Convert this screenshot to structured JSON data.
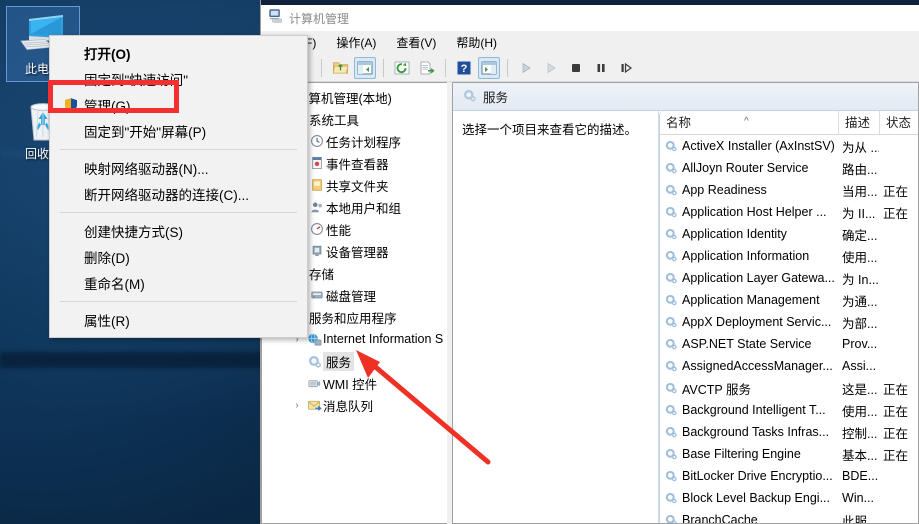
{
  "desktop": {
    "icons": [
      {
        "label": "此电脑",
        "icon": "this-pc-icon",
        "selected": true
      },
      {
        "label": "回收站",
        "icon": "recycle-bin-icon",
        "selected": false
      }
    ]
  },
  "context_menu": {
    "items": [
      {
        "label": "打开(O)",
        "bold": true,
        "icon": ""
      },
      {
        "label": "固定到\"快速访问\"",
        "bold": false,
        "icon": ""
      },
      {
        "label": "管理(G)",
        "bold": false,
        "icon": "shield-icon",
        "highlighted": true
      },
      {
        "label": "固定到\"开始\"屏幕(P)",
        "bold": false,
        "icon": ""
      },
      {
        "separator": true
      },
      {
        "label": "映射网络驱动器(N)...",
        "bold": false,
        "icon": ""
      },
      {
        "label": "断开网络驱动器的连接(C)...",
        "bold": false,
        "icon": ""
      },
      {
        "separator": true
      },
      {
        "label": "创建快捷方式(S)",
        "bold": false,
        "icon": ""
      },
      {
        "label": "删除(D)",
        "bold": false,
        "icon": ""
      },
      {
        "label": "重命名(M)",
        "bold": false,
        "icon": ""
      },
      {
        "separator": true
      },
      {
        "label": "属性(R)",
        "bold": false,
        "icon": ""
      }
    ]
  },
  "window": {
    "title": "计算机管理",
    "title_icon": "computer-management-icon",
    "menu": [
      {
        "label": "文件(F)"
      },
      {
        "label": "操作(A)"
      },
      {
        "label": "查看(V)"
      },
      {
        "label": "帮助(H)"
      }
    ],
    "toolbar": [
      {
        "name": "back-icon",
        "selected": false
      },
      {
        "name": "forward-icon",
        "selected": false
      },
      {
        "name": "up-folder-icon",
        "selected": false
      },
      {
        "name": "show-hide-tree-icon",
        "selected": true
      },
      {
        "name": "refresh-icon",
        "selected": false
      },
      {
        "name": "export-list-icon",
        "selected": false
      },
      {
        "name": "help-icon",
        "selected": false
      },
      {
        "name": "show-action-pane-icon",
        "selected": true
      },
      {
        "name": "start-service-icon",
        "selected": false
      },
      {
        "name": "resume-service-icon",
        "selected": false
      },
      {
        "name": "stop-service-icon",
        "selected": false
      },
      {
        "name": "pause-service-icon",
        "selected": false
      },
      {
        "name": "restart-service-icon",
        "selected": false
      }
    ]
  },
  "tree": {
    "nodes": [
      {
        "label": "计算机管理(本地)",
        "expander": "v",
        "icon": "computer-icon",
        "indent": 0,
        "selected": false
      },
      {
        "label": "系统工具",
        "expander": "v",
        "icon": "tools-icon",
        "indent": 1,
        "selected": false
      },
      {
        "label": "任务计划程序",
        "expander": "",
        "icon": "task-scheduler-icon",
        "indent": 2,
        "selected": false
      },
      {
        "label": "事件查看器",
        "expander": "",
        "icon": "event-viewer-icon",
        "indent": 2,
        "selected": false
      },
      {
        "label": "共享文件夹",
        "expander": "",
        "icon": "shared-folders-icon",
        "indent": 2,
        "selected": false
      },
      {
        "label": "本地用户和组",
        "expander": "",
        "icon": "local-users-icon",
        "indent": 2,
        "selected": false
      },
      {
        "label": "性能",
        "expander": "",
        "icon": "performance-icon",
        "indent": 2,
        "selected": false
      },
      {
        "label": "设备管理器",
        "expander": "",
        "icon": "device-manager-icon",
        "indent": 2,
        "selected": false
      },
      {
        "label": "存储",
        "expander": "v",
        "icon": "storage-icon",
        "indent": 1,
        "selected": false
      },
      {
        "label": "磁盘管理",
        "expander": "",
        "icon": "disk-management-icon",
        "indent": 2,
        "selected": false
      },
      {
        "label": "服务和应用程序",
        "expander": "v",
        "icon": "services-apps-icon",
        "indent": 1,
        "selected": false
      },
      {
        "label": "Internet Information S",
        "expander": ">",
        "icon": "iis-icon",
        "indent": 2,
        "selected": false
      },
      {
        "label": "服务",
        "expander": "",
        "icon": "services-icon",
        "indent": 2,
        "selected": true
      },
      {
        "label": "WMI 控件",
        "expander": "",
        "icon": "wmi-icon",
        "indent": 2,
        "selected": false
      },
      {
        "label": "消息队列",
        "expander": ">",
        "icon": "message-queue-icon",
        "indent": 2,
        "selected": false
      }
    ]
  },
  "services_pane": {
    "header_title": "服务",
    "header_icon": "services-icon",
    "description_placeholder": "选择一个项目来查看它的描述。",
    "columns": [
      {
        "label": "名称",
        "sorted": true,
        "sort_dir": "^"
      },
      {
        "label": "描述"
      },
      {
        "label": "状态"
      }
    ],
    "rows": [
      {
        "name": "ActiveX Installer (AxInstSV)",
        "desc": "为从 ...",
        "status": ""
      },
      {
        "name": "AllJoyn Router Service",
        "desc": "路由...",
        "status": ""
      },
      {
        "name": "App Readiness",
        "desc": "当用...",
        "status": "正在"
      },
      {
        "name": "Application Host Helper ...",
        "desc": "为 II...",
        "status": "正在"
      },
      {
        "name": "Application Identity",
        "desc": "确定...",
        "status": ""
      },
      {
        "name": "Application Information",
        "desc": "使用...",
        "status": ""
      },
      {
        "name": "Application Layer Gatewa...",
        "desc": "为 In...",
        "status": ""
      },
      {
        "name": "Application Management",
        "desc": "为通...",
        "status": ""
      },
      {
        "name": "AppX Deployment Servic...",
        "desc": "为部...",
        "status": ""
      },
      {
        "name": "ASP.NET State Service",
        "desc": "Prov...",
        "status": ""
      },
      {
        "name": "AssignedAccessManager...",
        "desc": "Assi...",
        "status": ""
      },
      {
        "name": "AVCTP 服务",
        "desc": "这是...",
        "status": "正在"
      },
      {
        "name": "Background Intelligent T...",
        "desc": "使用...",
        "status": "正在"
      },
      {
        "name": "Background Tasks Infras...",
        "desc": "控制...",
        "status": "正在"
      },
      {
        "name": "Base Filtering Engine",
        "desc": "基本...",
        "status": "正在"
      },
      {
        "name": "BitLocker Drive Encryptio...",
        "desc": "BDE...",
        "status": ""
      },
      {
        "name": "Block Level Backup Engi...",
        "desc": "Win...",
        "status": ""
      },
      {
        "name": "BranchCache",
        "desc": "此服...",
        "status": ""
      }
    ]
  },
  "annotations": {
    "highlight_color": "#f42f2f",
    "arrow_color": "#ee3124",
    "arrow_target": "服务"
  }
}
